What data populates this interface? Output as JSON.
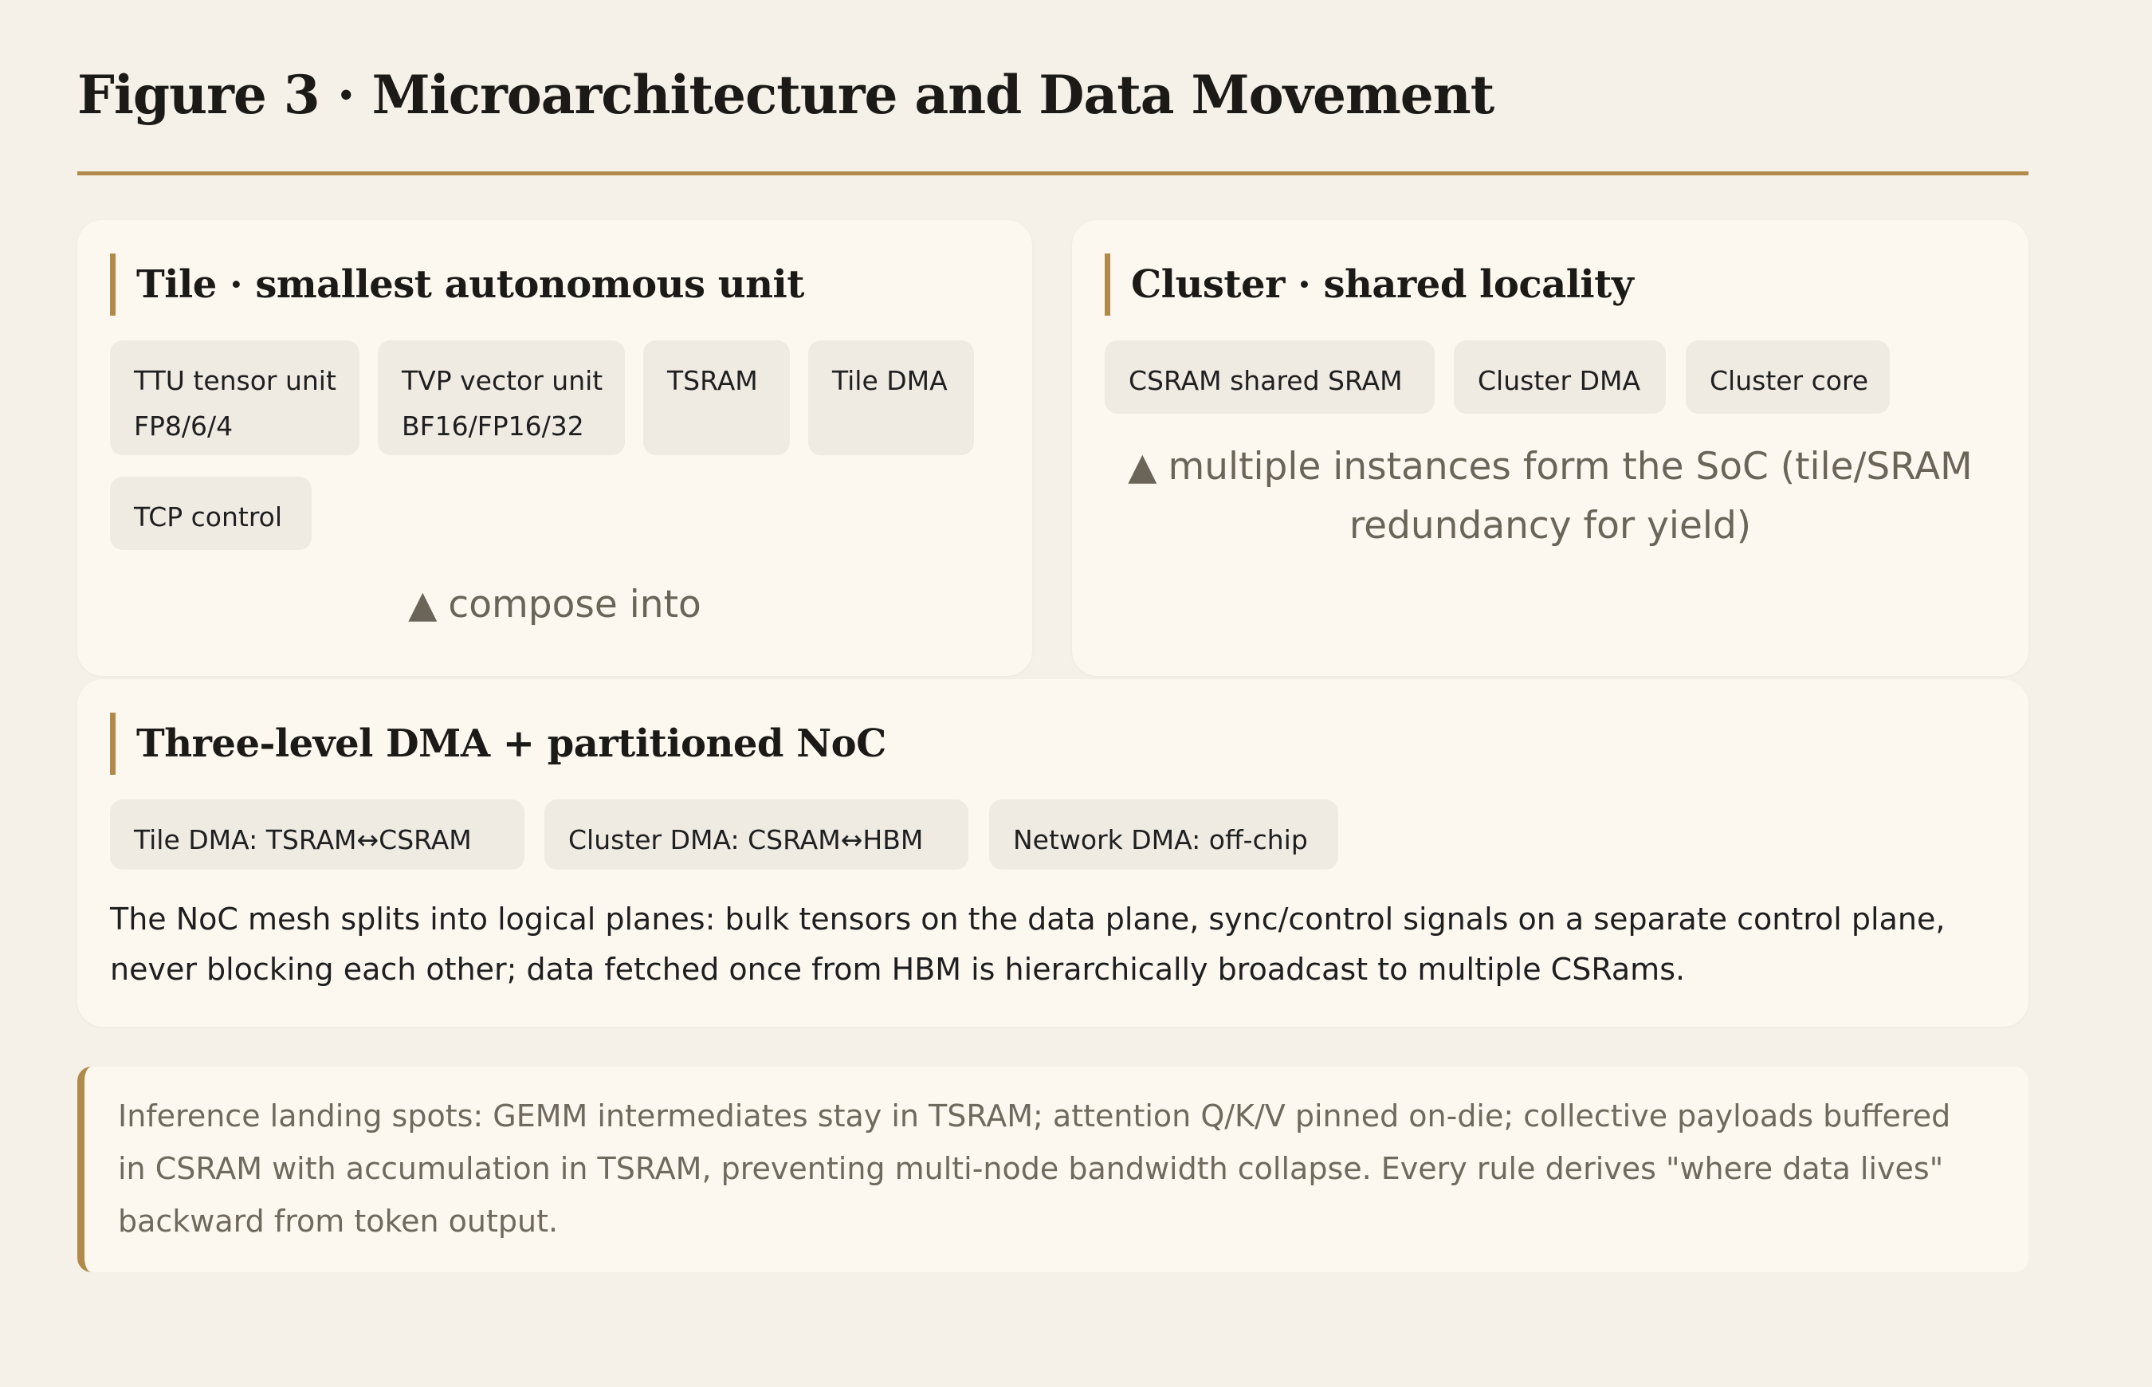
{
  "title": "Figure 3 · Microarchitecture and Data Movement",
  "tile": {
    "heading": "Tile · smallest autonomous unit",
    "chips": [
      {
        "line1": "TTU tensor unit",
        "line2": "FP8/6/4"
      },
      {
        "line1": "TVP vector unit",
        "line2": "BF16/FP16/32"
      },
      {
        "line1": "TSRAM",
        "line2": ""
      },
      {
        "line1": "Tile DMA",
        "line2": ""
      },
      {
        "line1": "TCP control",
        "line2": ""
      }
    ],
    "arrow_note": "compose into"
  },
  "cluster": {
    "heading": "Cluster · shared locality",
    "chips": [
      "CSRAM shared SRAM",
      "Cluster DMA",
      "Cluster core"
    ],
    "note_line1": "multiple instances form the SoC (tile/SRAM",
    "note_line2": "redundancy for yield)"
  },
  "dma": {
    "heading": "Three-level DMA + partitioned NoC",
    "chips": [
      "Tile DMA: TSRAM↔CSRAM",
      "Cluster DMA: CSRAM↔HBM",
      "Network DMA: off-chip"
    ],
    "body": "The NoC mesh splits into logical planes: bulk tensors on the data plane, sync/control signals on a separate control plane, never blocking each other; data fetched once from HBM is hierarchically broadcast to multiple CSRams."
  },
  "callout": "Inference landing spots: GEMM intermediates stay in TSRAM; attention Q/K/V pinned on-die; collective payloads buffered in CSRAM with accumulation in TSRAM, preventing multi-node bandwidth collapse. Every rule derives \"where data lives\" backward from token output.",
  "colors": {
    "background": "#f5f1e8",
    "card": "#fcf8f0",
    "accent": "#b08a4a",
    "chip": "#efebe3",
    "muted_text": "#6b6559"
  },
  "icons": {
    "arrow": "triangle-up-icon"
  }
}
